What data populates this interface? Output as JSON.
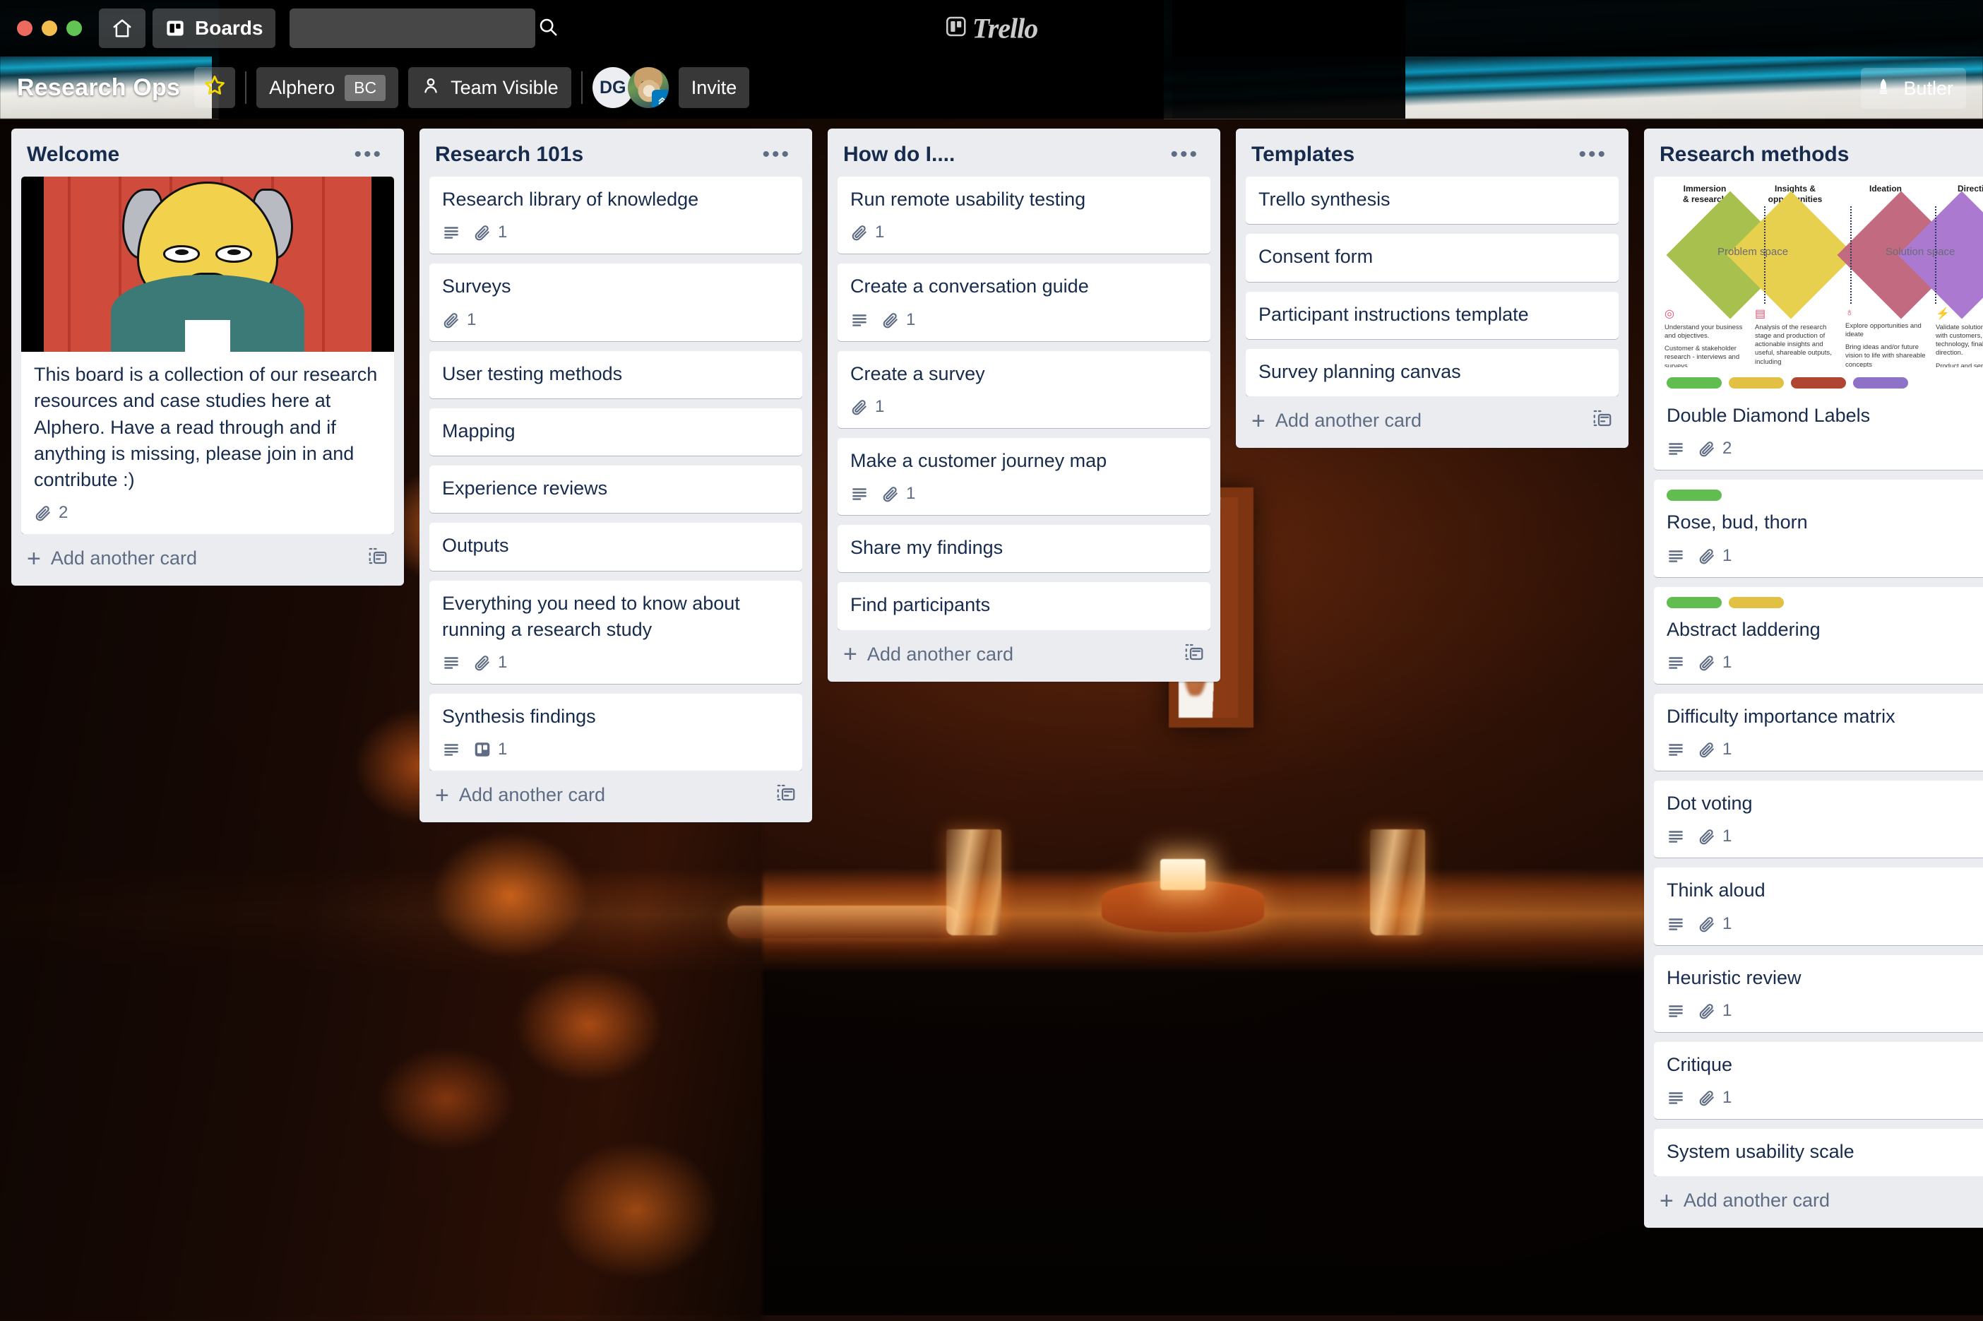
{
  "window": {
    "traffic_lights": [
      "close",
      "minimize",
      "zoom"
    ]
  },
  "topnav": {
    "home_icon": "home-icon",
    "boards_icon": "boards-icon",
    "boards_label": "Boards",
    "search_placeholder": "",
    "search_value": "",
    "search_icon": "search-icon",
    "brand": "Trello",
    "brand_icon": "trello-logo-icon"
  },
  "boardbar": {
    "title": "Research Ops",
    "star_icon": "star-icon",
    "team_name": "Alphero",
    "team_badge": "BC",
    "visibility_icon": "person-icon",
    "visibility_label": "Team Visible",
    "members": [
      {
        "type": "initials",
        "label": "DG"
      },
      {
        "type": "photo",
        "label": "",
        "badge_icon": "chevron-up-badge-icon"
      }
    ],
    "invite_label": "Invite",
    "butler_label": "Butler",
    "butler_icon": "butler-icon"
  },
  "common": {
    "add_card_label": "Add another card",
    "add_card_plus": "+",
    "card_template_icon": "card-template-icon",
    "list_menu_icon": "list-menu-icon",
    "description_icon": "description-icon",
    "attachment_icon": "attachment-icon",
    "board_attachment_icon": "trello-board-icon"
  },
  "label_colors": {
    "green": "#61bd4f",
    "yellow": "#e2c044",
    "orange_red": "#b04632",
    "purple": "#8e72c7"
  },
  "lists": [
    {
      "title": "Welcome",
      "cards": [
        {
          "title": "This board is a collection of our research resources and case studies here at Alphero. Have a read through and if anything is missing, please join in and contribute :)",
          "cover": "mr-burns-image",
          "badges": [
            {
              "icon": "attachment-icon",
              "count": "2"
            }
          ],
          "labels": []
        }
      ]
    },
    {
      "title": "Research 101s",
      "cards": [
        {
          "title": "Research library of knowledge",
          "badges": [
            {
              "icon": "description-icon"
            },
            {
              "icon": "attachment-icon",
              "count": "1"
            }
          ],
          "labels": []
        },
        {
          "title": "Surveys",
          "badges": [
            {
              "icon": "attachment-icon",
              "count": "1"
            }
          ],
          "labels": []
        },
        {
          "title": "User testing methods",
          "badges": [],
          "labels": []
        },
        {
          "title": "Mapping",
          "badges": [],
          "labels": []
        },
        {
          "title": "Experience reviews",
          "badges": [],
          "labels": []
        },
        {
          "title": "Outputs",
          "badges": [],
          "labels": []
        },
        {
          "title": "Everything you need to know about running a research study",
          "badges": [
            {
              "icon": "description-icon"
            },
            {
              "icon": "attachment-icon",
              "count": "1"
            }
          ],
          "labels": []
        },
        {
          "title": "Synthesis findings",
          "badges": [
            {
              "icon": "description-icon"
            },
            {
              "icon": "trello-board-icon",
              "count": "1"
            }
          ],
          "labels": []
        }
      ]
    },
    {
      "title": "How do I....",
      "cards": [
        {
          "title": "Run remote usability testing",
          "badges": [
            {
              "icon": "attachment-icon",
              "count": "1"
            }
          ],
          "labels": []
        },
        {
          "title": "Create a conversation guide",
          "badges": [
            {
              "icon": "description-icon"
            },
            {
              "icon": "attachment-icon",
              "count": "1"
            }
          ],
          "labels": []
        },
        {
          "title": "Create a survey",
          "badges": [
            {
              "icon": "attachment-icon",
              "count": "1"
            }
          ],
          "labels": []
        },
        {
          "title": "Make a customer journey map",
          "badges": [
            {
              "icon": "description-icon"
            },
            {
              "icon": "attachment-icon",
              "count": "1"
            }
          ],
          "labels": []
        },
        {
          "title": "Share my findings",
          "badges": [],
          "labels": []
        },
        {
          "title": "Find participants",
          "badges": [],
          "labels": []
        }
      ]
    },
    {
      "title": "Templates",
      "cards": [
        {
          "title": "Trello synthesis",
          "badges": [],
          "labels": []
        },
        {
          "title": "Consent form",
          "badges": [],
          "labels": []
        },
        {
          "title": "Participant instructions template",
          "badges": [],
          "labels": []
        },
        {
          "title": "Survey planning canvas",
          "badges": [],
          "labels": []
        }
      ]
    },
    {
      "title": "Research methods",
      "cards": [
        {
          "title": "Double Diamond Labels",
          "cover": "double-diamond-image",
          "badges": [
            {
              "icon": "description-icon"
            },
            {
              "icon": "attachment-icon",
              "count": "2"
            }
          ],
          "labels": [
            "green",
            "yellow",
            "orange_red",
            "purple"
          ]
        },
        {
          "title": "Rose, bud, thorn",
          "badges": [
            {
              "icon": "description-icon"
            },
            {
              "icon": "attachment-icon",
              "count": "1"
            }
          ],
          "labels": [
            "green"
          ]
        },
        {
          "title": "Abstract laddering",
          "badges": [
            {
              "icon": "description-icon"
            },
            {
              "icon": "attachment-icon",
              "count": "1"
            }
          ],
          "labels": [
            "green",
            "yellow"
          ]
        },
        {
          "title": "Difficulty importance matrix",
          "badges": [
            {
              "icon": "description-icon"
            },
            {
              "icon": "attachment-icon",
              "count": "1"
            }
          ],
          "labels": []
        },
        {
          "title": "Dot voting",
          "badges": [
            {
              "icon": "description-icon"
            },
            {
              "icon": "attachment-icon",
              "count": "1"
            }
          ],
          "labels": []
        },
        {
          "title": "Think aloud",
          "badges": [
            {
              "icon": "description-icon"
            },
            {
              "icon": "attachment-icon",
              "count": "1"
            }
          ],
          "labels": []
        },
        {
          "title": "Heuristic review",
          "badges": [
            {
              "icon": "description-icon"
            },
            {
              "icon": "attachment-icon",
              "count": "1"
            }
          ],
          "labels": []
        },
        {
          "title": "Critique",
          "badges": [
            {
              "icon": "description-icon"
            },
            {
              "icon": "attachment-icon",
              "count": "1"
            }
          ],
          "labels": []
        },
        {
          "title": "System usability scale",
          "badges": [],
          "labels": []
        }
      ]
    }
  ],
  "double_diamond": {
    "phases": [
      "Immersion\n& research",
      "Insights &\nopportunities",
      "Ideation",
      "Direction"
    ],
    "space_labels": [
      "Problem space",
      "Solution space"
    ],
    "descriptions": [
      "Understand your business and objectives.\n\nCustomer & stakeholder research - interviews and surveys",
      "Analysis of the research stage and production of actionable insights and useful, shareable outputs, including recommendations for next steps",
      "Explore opportunities and ideate\n\nBring ideas and/or future vision to life with shareable concepts",
      "Validate solutions or vision with customers, team and technology, finalise direction.\n\nProduct and service strategy roadmap."
    ],
    "icons": [
      "target-icon",
      "document-icon",
      "lightbulb-icon",
      "lightning-icon"
    ],
    "diamond_colors": [
      "#a8c04d",
      "#e8d04f",
      "#c26a7f",
      "#ab7ad0"
    ]
  }
}
